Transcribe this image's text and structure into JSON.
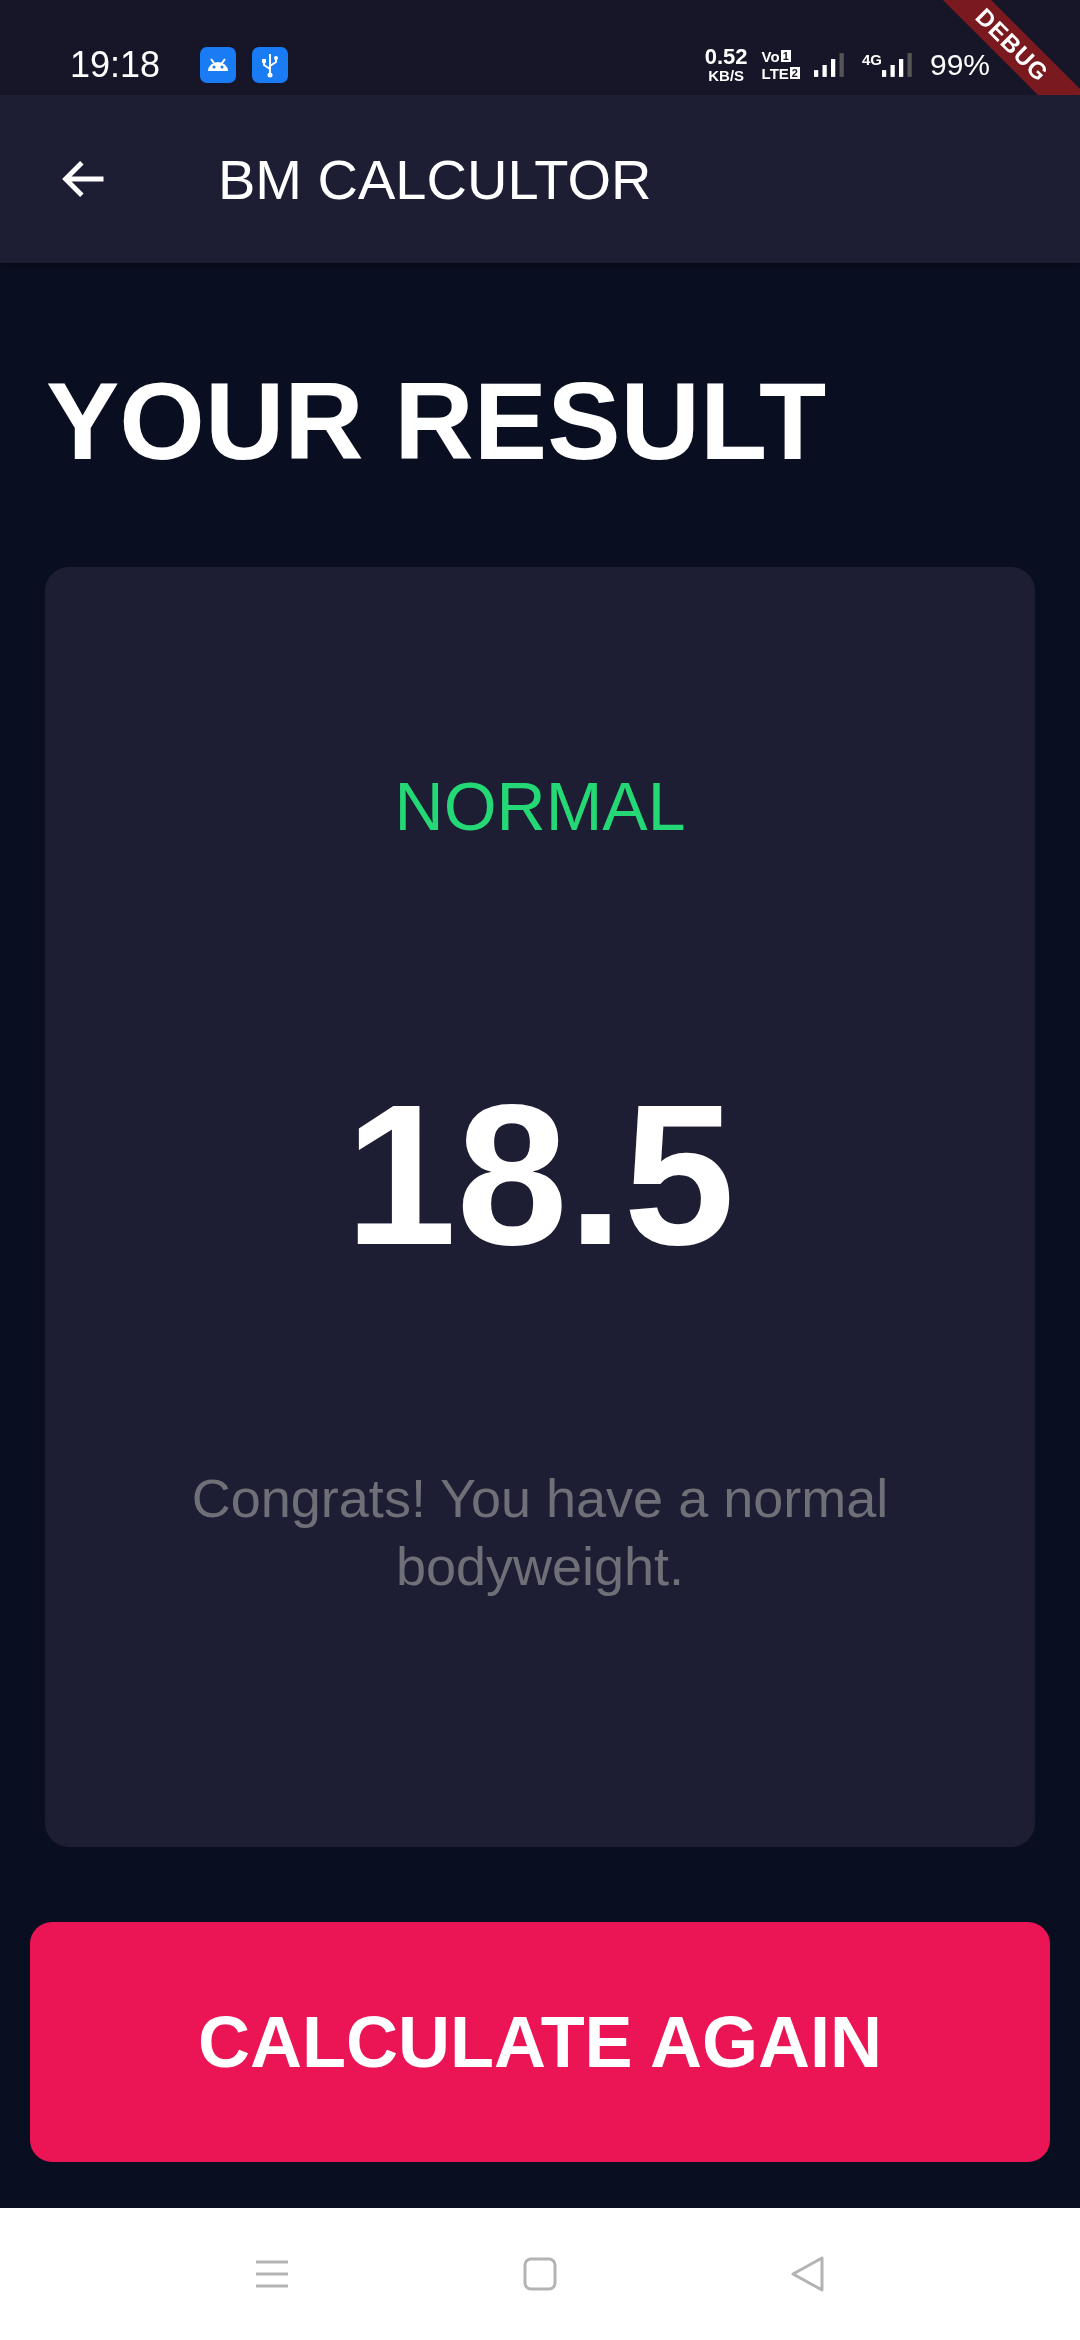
{
  "status_bar": {
    "time": "19:18",
    "speed_value": "0.52",
    "speed_unit": "KB/S",
    "volte_top": "Vo",
    "volte_top_sim": "1",
    "volte_bottom": "LTE",
    "volte_bottom_sim": "2",
    "network": "4G",
    "battery": "99%"
  },
  "debug_banner": "DEBUG",
  "app_bar": {
    "title": "BM CALCULTOR"
  },
  "heading": "YOUR RESULT",
  "result": {
    "category": "NORMAL",
    "color": "#24d876",
    "value": "18.5",
    "message": "Congrats! You have a normal bodyweight."
  },
  "button": "CALCULATE AGAIN"
}
